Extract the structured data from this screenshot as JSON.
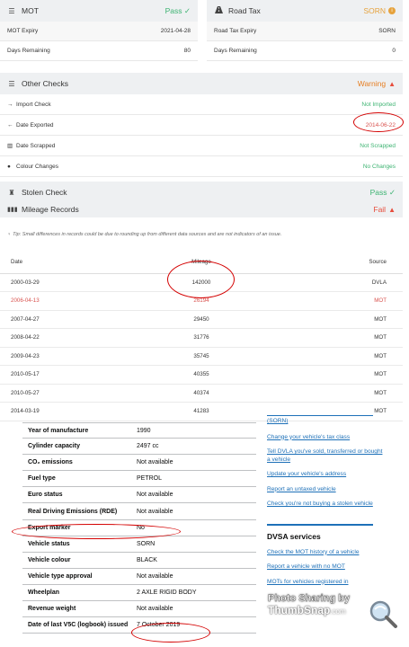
{
  "mot": {
    "title": "MOT",
    "status": "Pass ✓",
    "rows": [
      {
        "key": "MOT Expiry",
        "value": "2021-04-28"
      },
      {
        "key": "Days Remaining",
        "value": "80"
      }
    ]
  },
  "road_tax": {
    "title": "Road Tax",
    "status": "SORN",
    "rows": [
      {
        "key": "Road Tax Expiry",
        "value": "SORN"
      },
      {
        "key": "Days Remaining",
        "value": "0"
      }
    ]
  },
  "other_checks": {
    "title": "Other Checks",
    "status": "Warning",
    "rows": [
      {
        "key": "Import Check",
        "value": "Not Imported"
      },
      {
        "key": "Date Exported",
        "value": "2014-06-22"
      },
      {
        "key": "Date Scrapped",
        "value": "Not Scrapped"
      },
      {
        "key": "Colour Changes",
        "value": "No Changes"
      }
    ]
  },
  "stolen_check": {
    "title": "Stolen Check",
    "status": "Pass ✓"
  },
  "mileage": {
    "title": "Mileage Records",
    "status": "Fail",
    "tip": "Tip: Small differences in records could be due to rounding up from different data sources and are not indicators of an issue.",
    "headers": [
      "Date",
      "Mileage",
      "Source"
    ],
    "rows": [
      {
        "date": "2000-03-29",
        "mileage": "142000",
        "source": "DVLA"
      },
      {
        "date": "2006-04-13",
        "mileage": "26194",
        "source": "MOT"
      },
      {
        "date": "2007-04-27",
        "mileage": "29450",
        "source": "MOT"
      },
      {
        "date": "2008-04-22",
        "mileage": "31776",
        "source": "MOT"
      },
      {
        "date": "2009-04-23",
        "mileage": "35745",
        "source": "MOT"
      },
      {
        "date": "2010-05-17",
        "mileage": "40355",
        "source": "MOT"
      },
      {
        "date": "2010-05-27",
        "mileage": "40374",
        "source": "MOT"
      },
      {
        "date": "2014-03-19",
        "mileage": "41283",
        "source": "MOT"
      }
    ]
  },
  "vehicle_details": [
    {
      "key": "Year of manufacture",
      "value": "1990"
    },
    {
      "key": "Cylinder capacity",
      "value": "2497 cc"
    },
    {
      "key": "CO₂ emissions",
      "value": "Not available"
    },
    {
      "key": "Fuel type",
      "value": "PETROL"
    },
    {
      "key": "Euro status",
      "value": "Not available"
    },
    {
      "key": "Real Driving Emissions (RDE)",
      "value": "Not available"
    },
    {
      "key": "Export marker",
      "value": "No"
    },
    {
      "key": "Vehicle status",
      "value": "SORN"
    },
    {
      "key": "Vehicle colour",
      "value": "BLACK"
    },
    {
      "key": "Vehicle type approval",
      "value": "Not available"
    },
    {
      "key": "Wheelplan",
      "value": "2 AXLE RIGID BODY"
    },
    {
      "key": "Revenue weight",
      "value": "Not available"
    },
    {
      "key": "Date of last V5C (logbook) issued",
      "value": "7 October 2019"
    }
  ],
  "related_links": [
    "(SORN)",
    "Change your vehicle's tax class",
    "Tell DVLA you've sold, transferred or bought a vehicle",
    "Update your vehicle's address",
    "Report an untaxed vehicle",
    "Check you're not buying a stolen vehicle"
  ],
  "dvsa": {
    "heading": "DVSA services",
    "links": [
      "Check the MOT history of a vehicle",
      "Report a vehicle with no MOT",
      "MOTs for vehicles registered in"
    ]
  },
  "watermark": {
    "line1": "Photo Sharing by",
    "brand": "ThumbSnap",
    "suffix": ".com"
  },
  "colors": {
    "pass": "#3cb371",
    "warning": "#e67e22",
    "fail": "#e74c3c",
    "link": "#1d70b8",
    "annotation": "#d40000"
  }
}
